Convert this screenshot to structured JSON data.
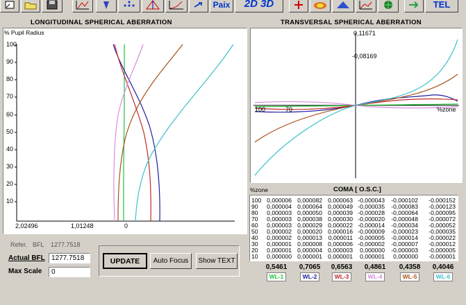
{
  "toolbar": {
    "icons": [
      "zoom-icon",
      "folder-icon",
      "save-icon",
      "layout-plot-icon",
      "lens-icon",
      "spot-dots-icon",
      "ray-fan-icon",
      "aberration-curve-icon",
      "tool-arrow-icon",
      "paix-icon",
      "mode-2d3d-icon",
      "target-icon",
      "heatmap-icon",
      "surface-3d-icon",
      "chart-icon",
      "sphere-icon",
      "arrow-tool-icon",
      "tel-icon"
    ],
    "paix_label": "Paix",
    "mode_label": "2D 3D",
    "tel_label": "TEL"
  },
  "left_panel": {
    "title": "LONGITUDINAL SPHERICAL  ABERRATION",
    "y_axis_label": "% Pupil Radius",
    "y_ticks": [
      "100",
      "90",
      "80",
      "70",
      "60",
      "50",
      "40",
      "30",
      "20",
      "10"
    ],
    "x_ticks": [
      "2,02496",
      "1,01248",
      "0"
    ]
  },
  "right_panel": {
    "title": "TRANSVERSAL SPHERICAL ABERRATION",
    "top_value": "0,11671",
    "mid_value": "-0,08169",
    "left_axis_label": "100",
    "mid_axis_label": "70",
    "zone_label": "%zone"
  },
  "info": {
    "refer_label": "Refer.",
    "bfl_label": "BFL",
    "bfl_value": "1277.7518",
    "actual_bfl_label": "Actual BFL",
    "actual_bfl_value": "1277.7518",
    "max_scale_label": "Max Scale",
    "max_scale_value": "0"
  },
  "buttons": {
    "update": "UPDATE",
    "auto_focus": "Auto Focus",
    "show_text": "Show TEXT"
  },
  "coma": {
    "zone_header": "%zone",
    "title": "COMA [ O.S.C.]",
    "rows": [
      [
        "100",
        "0,000006",
        "0,000082",
        "0,000063",
        "-0,000043",
        "-0,000102",
        "-0,000152"
      ],
      [
        "90",
        "0,000004",
        "0,000064",
        "0,000049",
        "-0,000035",
        "-0,000083",
        "-0,000123"
      ],
      [
        "80",
        "0,000003",
        "0,000050",
        "0,000039",
        "-0,000028",
        "-0,000064",
        "-0,000095"
      ],
      [
        "70",
        "0,000003",
        "0,000038",
        "0,000030",
        "-0,000020",
        "-0,000048",
        "-0,000072"
      ],
      [
        "60",
        "0,000003",
        "0,000029",
        "0,000022",
        "-0,000014",
        "-0,000034",
        "-0,000052"
      ],
      [
        "50",
        "0,000002",
        "0,000020",
        "0,000016",
        "-0,000009",
        "-0,000023",
        "-0,000035"
      ],
      [
        "40",
        "0,000002",
        "0,000013",
        "0,000011",
        "-0,000005",
        "-0,000014",
        "-0,000022"
      ],
      [
        "30",
        "0,000001",
        "0,000008",
        "0,000006",
        "-0,000002",
        "-0,000007",
        "-0,000012"
      ],
      [
        "20",
        "0,000001",
        "0,000004",
        "0,000003",
        "0,000000",
        "-0,000003",
        "-0,000005"
      ],
      [
        "10",
        "0,000000",
        "0,000001",
        "0,000001",
        "0,000001",
        "0,000000",
        "-0,000001"
      ]
    ]
  },
  "wavelengths": [
    {
      "value": "0,5461",
      "label": "WL-1",
      "color": "#22c33a"
    },
    {
      "value": "0,7065",
      "label": "WL-2",
      "color": "#1d1d9e"
    },
    {
      "value": "0,6563",
      "label": "WL-3",
      "color": "#c0282b"
    },
    {
      "value": "0,4861",
      "label": "WL-4",
      "color": "#d98be0"
    },
    {
      "value": "0,4358",
      "label": "WL-5",
      "color": "#a8501a"
    },
    {
      "value": "0,4046",
      "label": "WL-6",
      "color": "#3ec0cc"
    }
  ]
}
